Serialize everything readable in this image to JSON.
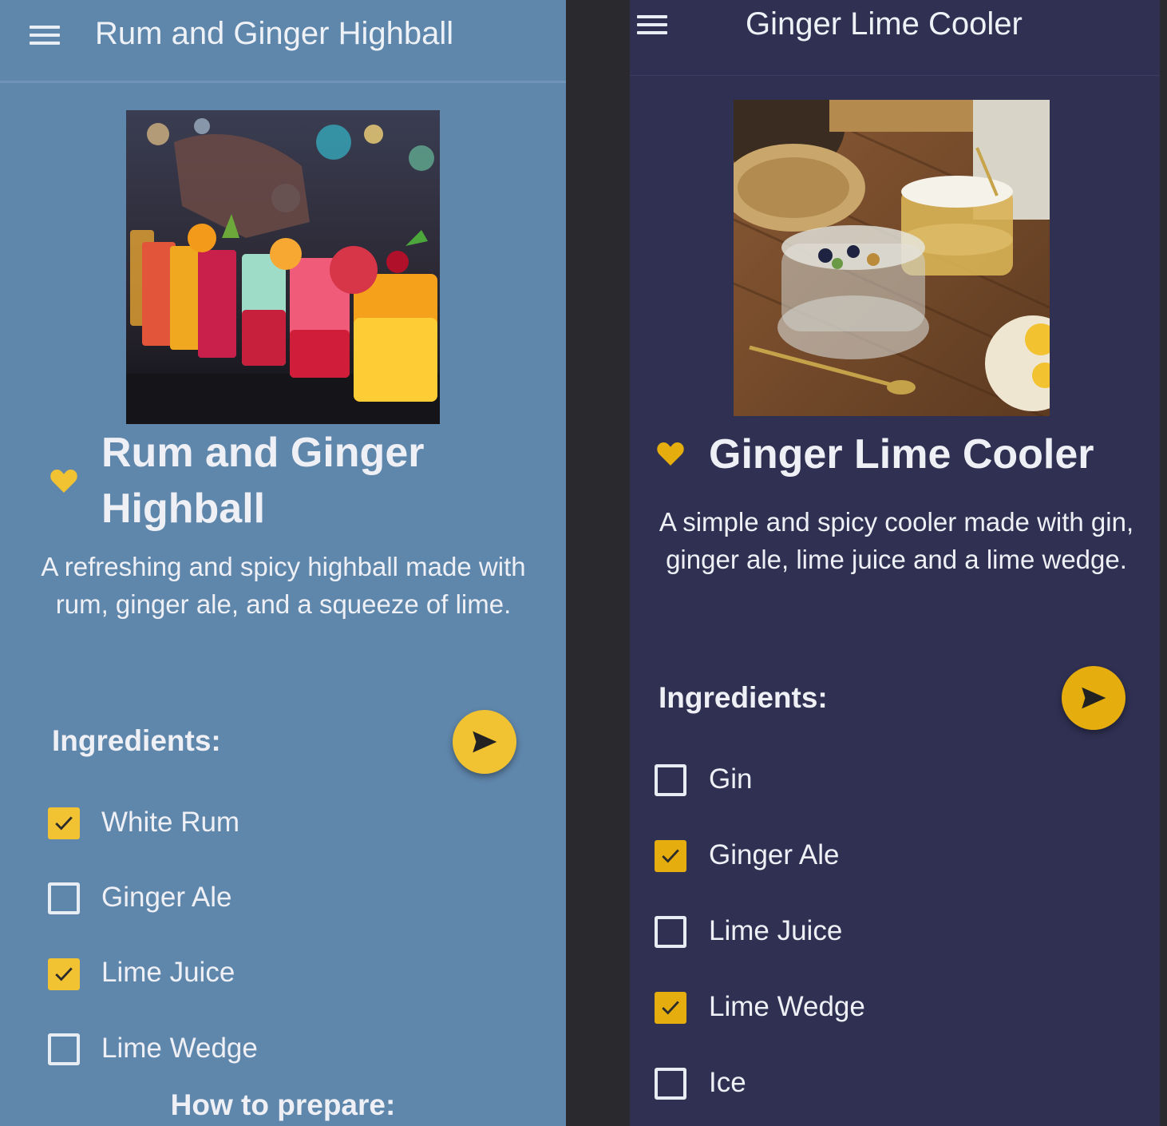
{
  "left_screen": {
    "appbar": {
      "title": "Rum and Ginger Highball"
    },
    "recipe": {
      "title": "Rum and Ginger Highball",
      "description": "A refreshing and spicy highball made with rum, ginger ale, and a squeeze of lime."
    },
    "ingredients_heading": "Ingredients:",
    "ingredients": [
      {
        "label": "White Rum",
        "checked": true
      },
      {
        "label": "Ginger Ale",
        "checked": false
      },
      {
        "label": "Lime Juice",
        "checked": true
      },
      {
        "label": "Lime Wedge",
        "checked": false
      }
    ],
    "prepare_heading": "How to prepare:",
    "colors": {
      "background": "#5f86ab",
      "accent": "#f1c232"
    }
  },
  "right_screen": {
    "appbar": {
      "title": "Ginger Lime Cooler"
    },
    "recipe": {
      "title": "Ginger Lime Cooler",
      "description": "A simple and spicy cooler made with gin, ginger ale, lime juice and a lime wedge."
    },
    "ingredients_heading": "Ingredients:",
    "ingredients": [
      {
        "label": "Gin",
        "checked": false
      },
      {
        "label": "Ginger Ale",
        "checked": true
      },
      {
        "label": "Lime Juice",
        "checked": false
      },
      {
        "label": "Lime Wedge",
        "checked": true
      },
      {
        "label": "Ice",
        "checked": false
      }
    ],
    "colors": {
      "background": "#2f3052",
      "accent": "#e5ad0d"
    }
  },
  "icons": {
    "menu": "menu-icon",
    "favorite": "heart-icon",
    "share": "send-icon",
    "checkbox_checked": "check-icon"
  }
}
